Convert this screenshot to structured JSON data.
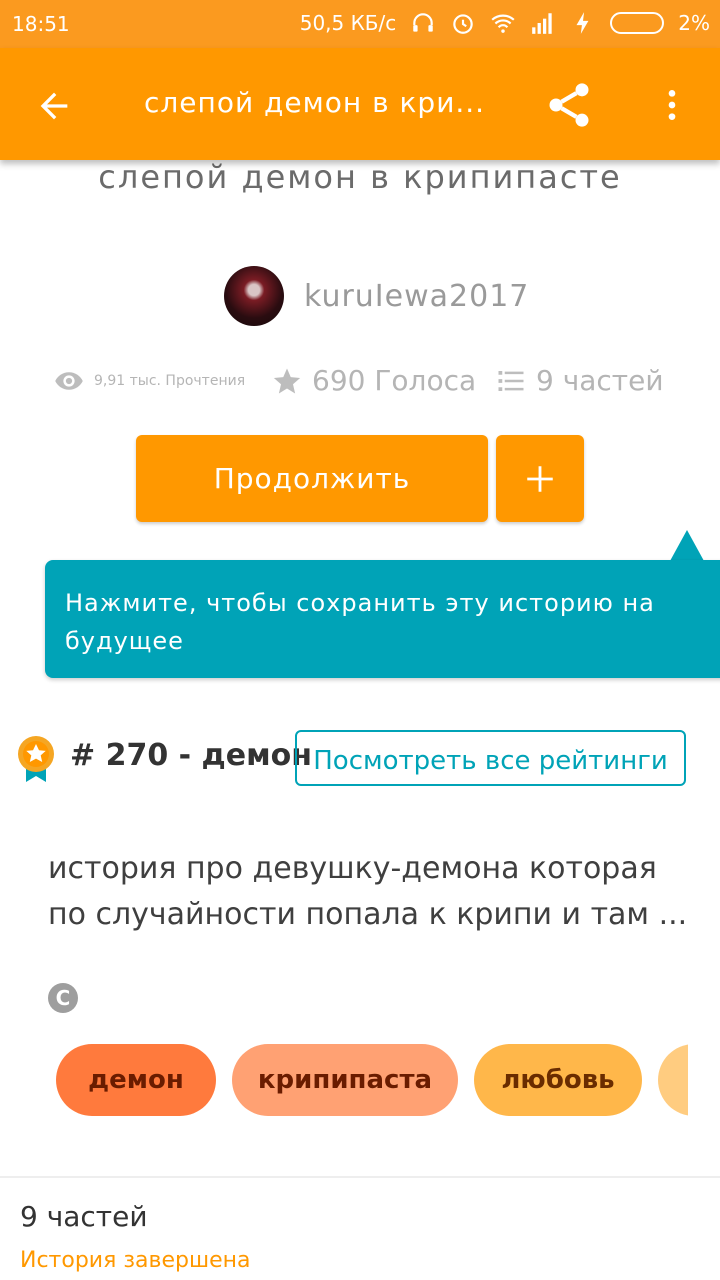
{
  "status_bar": {
    "time": "18:51",
    "speed": "50,5 КБ/с",
    "battery": "2%",
    "icons": [
      "headphones-icon",
      "alarm-icon",
      "wifi-icon",
      "signal-icon",
      "charging-icon",
      "battery-icon"
    ]
  },
  "app_bar": {
    "title": "слепой демон в кри...",
    "back_icon": "arrow-back-icon",
    "share_icon": "share-icon",
    "more_icon": "more-vert-icon"
  },
  "story": {
    "title": "слепой демон в крипипасте",
    "author": "kuruIewa2017",
    "reads": "9,91 тыс. Прочтения",
    "votes": "690 Голоса",
    "parts": "9 частей"
  },
  "actions": {
    "continue_label": "Продолжить",
    "add_label": "+"
  },
  "tooltip": {
    "text": "Нажмите, чтобы сохранить эту историю на будущее"
  },
  "rank": {
    "text": "# 270 - демон",
    "button_label": "Посмотреть все рейтинги"
  },
  "description": "история про девушку-демона которая по случайности попала к крипи и там ...",
  "copyright_symbol": "C",
  "tags": [
    "демон",
    "крипипаста",
    "любовь",
    ""
  ],
  "footer": {
    "parts_label": "9 частей",
    "status": "История завершена"
  },
  "colors": {
    "primary": "#ff9800",
    "accent": "#00a3b7",
    "status_bar": "#fb9a1f"
  }
}
